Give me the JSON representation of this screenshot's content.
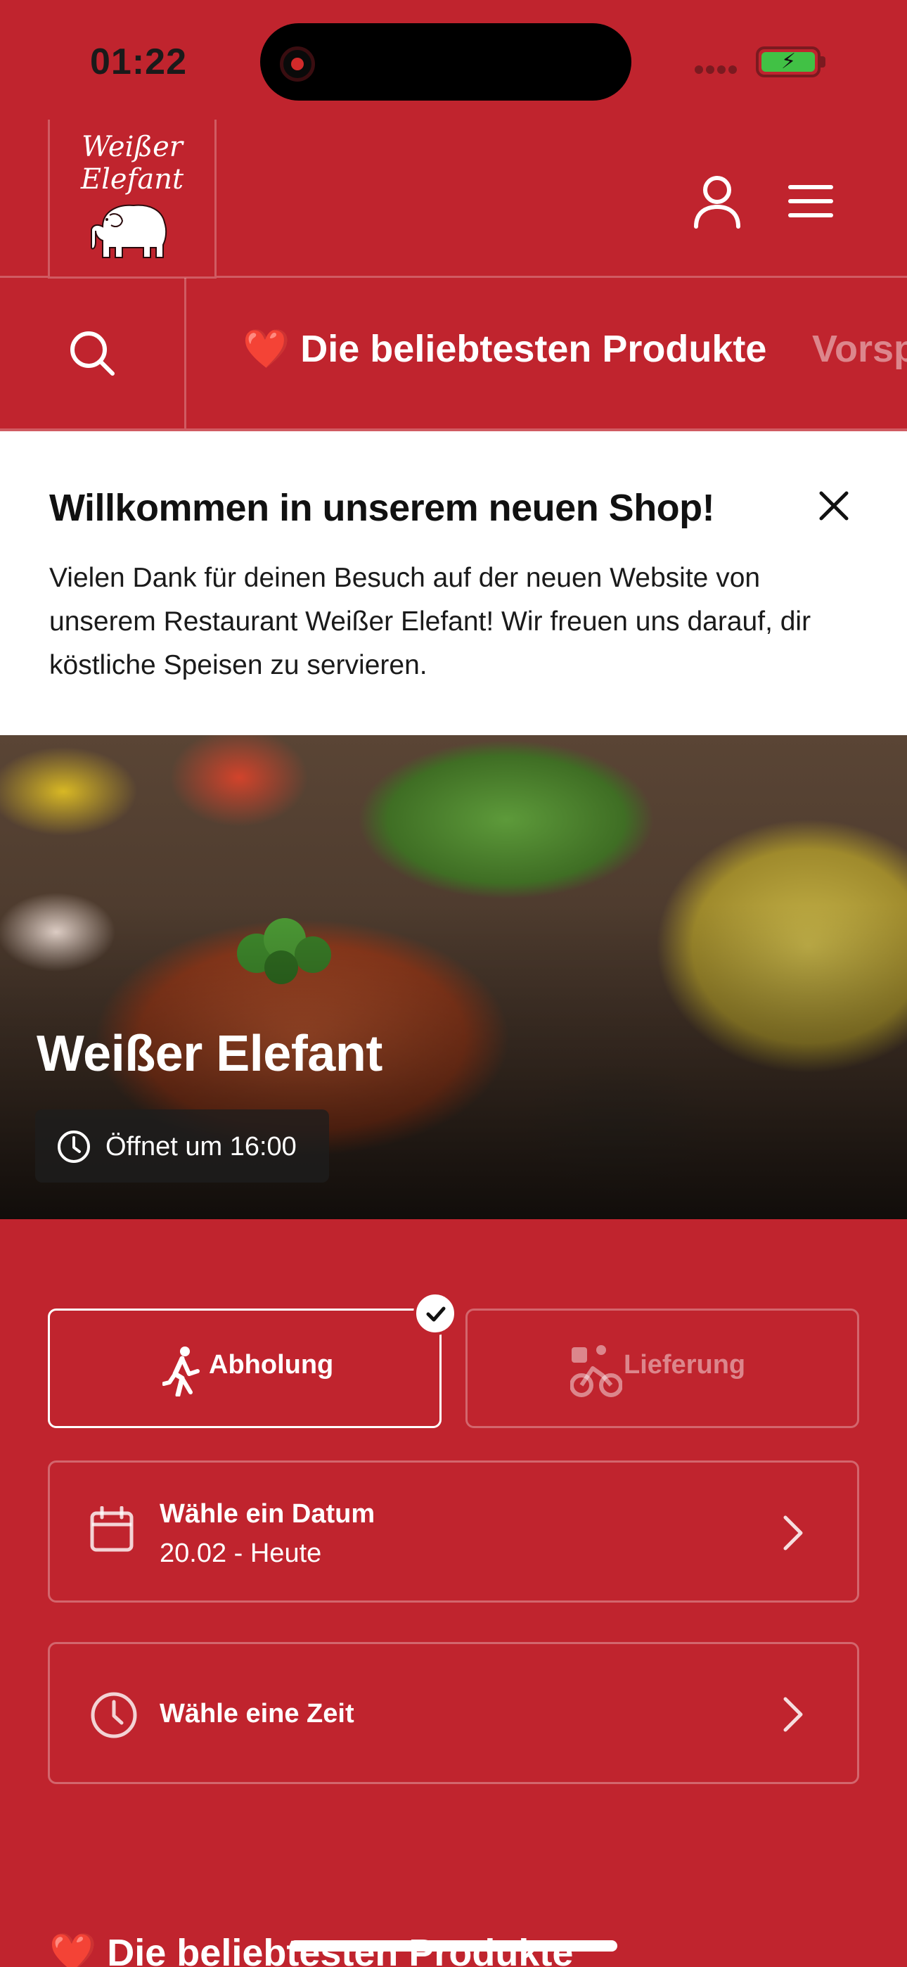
{
  "status_bar": {
    "time": "01:22"
  },
  "header": {
    "logo_line1": "Weißer",
    "logo_line2": "Elefant",
    "account_icon": "user-icon",
    "menu_icon": "hamburger-menu-icon"
  },
  "nav": {
    "search_icon": "search-icon",
    "active_tab_emoji": "❤️",
    "active_tab": "Die beliebtesten Produkte",
    "next_tab": "Vorsp"
  },
  "welcome": {
    "title": "Willkommen in unserem neuen Shop!",
    "body": "Vielen Dank für deinen Besuch auf der neuen Website von unserem Restaurant Weißer Elefant! Wir freuen uns darauf, dir köstliche Speisen zu servieren."
  },
  "hero": {
    "restaurant_name": "Weißer Elefant",
    "opening_status": "Öffnet um 16:00"
  },
  "order_mode": {
    "pickup_label": "Abholung",
    "delivery_label": "Lieferung",
    "selected": "pickup"
  },
  "date_selector": {
    "title": "Wähle ein Datum",
    "value": "20.02 - Heute"
  },
  "time_selector": {
    "title": "Wähle eine Zeit"
  },
  "section": {
    "emoji": "❤️",
    "title": "Die beliebtesten Produkte"
  },
  "colors": {
    "brand_red": "#c0242e",
    "white": "#ffffff",
    "battery_green": "#41c145"
  }
}
